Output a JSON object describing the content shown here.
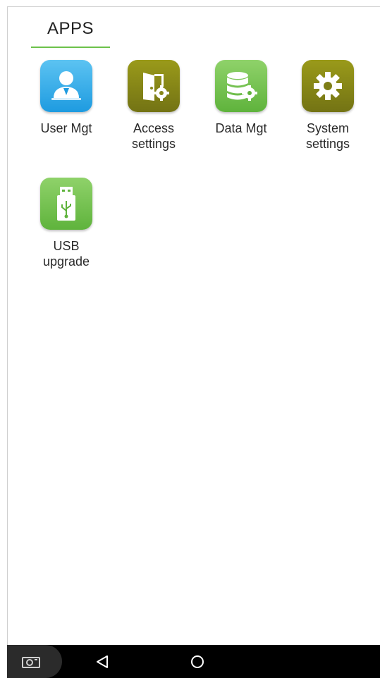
{
  "tabs": [
    {
      "label": "APPS",
      "active": true
    }
  ],
  "apps": [
    {
      "label": "User Mgt",
      "icon": "user-icon",
      "color": "#2ba6e6"
    },
    {
      "label": "Access\nsettings",
      "icon": "door-gear-icon",
      "color": "#868617"
    },
    {
      "label": "Data Mgt",
      "icon": "database-gear-icon",
      "color": "#72c04c"
    },
    {
      "label": "System\nsettings",
      "icon": "gear-icon",
      "color": "#868617"
    },
    {
      "label": "USB\nupgrade",
      "icon": "usb-drive-icon",
      "color": "#72c04c"
    }
  ],
  "navbar": {
    "buttons": [
      "camera-icon",
      "back-icon",
      "home-icon"
    ]
  },
  "colors": {
    "accent": "#6cc24a",
    "navbar": "#000000"
  }
}
